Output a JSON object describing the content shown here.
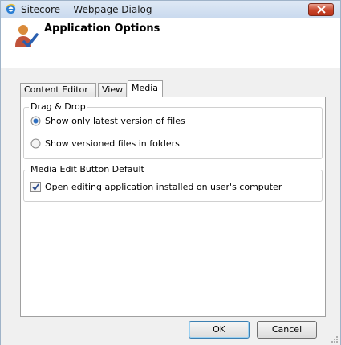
{
  "window": {
    "title": "Sitecore -- Webpage Dialog",
    "icon": "ie-icon"
  },
  "header": {
    "title": "Application Options",
    "icon": "user-check-icon"
  },
  "tabs": [
    {
      "label": "Content Editor",
      "active": false
    },
    {
      "label": "View",
      "active": false
    },
    {
      "label": "Media",
      "active": true
    }
  ],
  "drag_drop": {
    "legend": "Drag & Drop",
    "options": [
      {
        "label": "Show only latest version of files",
        "selected": true
      },
      {
        "label": "Show versioned files in folders",
        "selected": false
      }
    ]
  },
  "media_edit": {
    "legend": "Media Edit Button Default",
    "checkbox_label": "Open editing application installed on user's computer",
    "checked": true
  },
  "buttons": {
    "ok": "OK",
    "cancel": "Cancel"
  },
  "colors": {
    "accent": "#3c7fb1",
    "close": "#c8452b"
  }
}
